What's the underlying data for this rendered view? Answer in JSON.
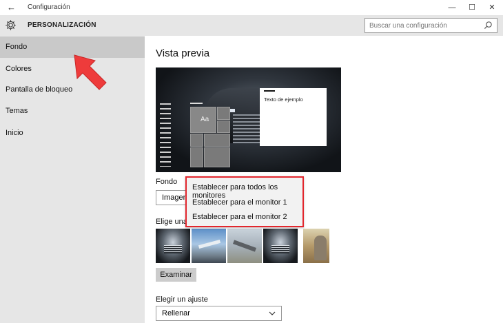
{
  "window": {
    "title": "Configuración",
    "back_glyph": "←",
    "minimize_glyph": "—",
    "maximize_glyph": "☐",
    "close_glyph": "✕"
  },
  "header": {
    "section_title": "PERSONALIZACIÓN",
    "search_placeholder": "Buscar una configuración"
  },
  "sidebar": {
    "items": [
      {
        "label": "Fondo",
        "active": true
      },
      {
        "label": "Colores",
        "active": false
      },
      {
        "label": "Pantalla de bloqueo",
        "active": false
      },
      {
        "label": "Temas",
        "active": false
      },
      {
        "label": "Inicio",
        "active": false
      }
    ]
  },
  "main": {
    "preview_title": "Vista previa",
    "preview_tile_text": "Aa",
    "preview_sample_text": "Texto de ejemplo",
    "fondo_label": "Fondo",
    "fondo_select_value": "Imagen",
    "choose_label": "Elige una i",
    "browse_button": "Examinar",
    "fit_label": "Elegir un ajuste",
    "fit_select_value": "Rellenar"
  },
  "context_menu": {
    "options": [
      "Establecer para todos los monitores",
      "Establecer para el monitor 1",
      "Establecer para el monitor 2"
    ]
  },
  "colors": {
    "highlight_border": "#e3262d",
    "arrow": "#ee3b3b",
    "sidebar_bg": "#e6e6e6",
    "sidebar_active": "#c9c9c9"
  }
}
